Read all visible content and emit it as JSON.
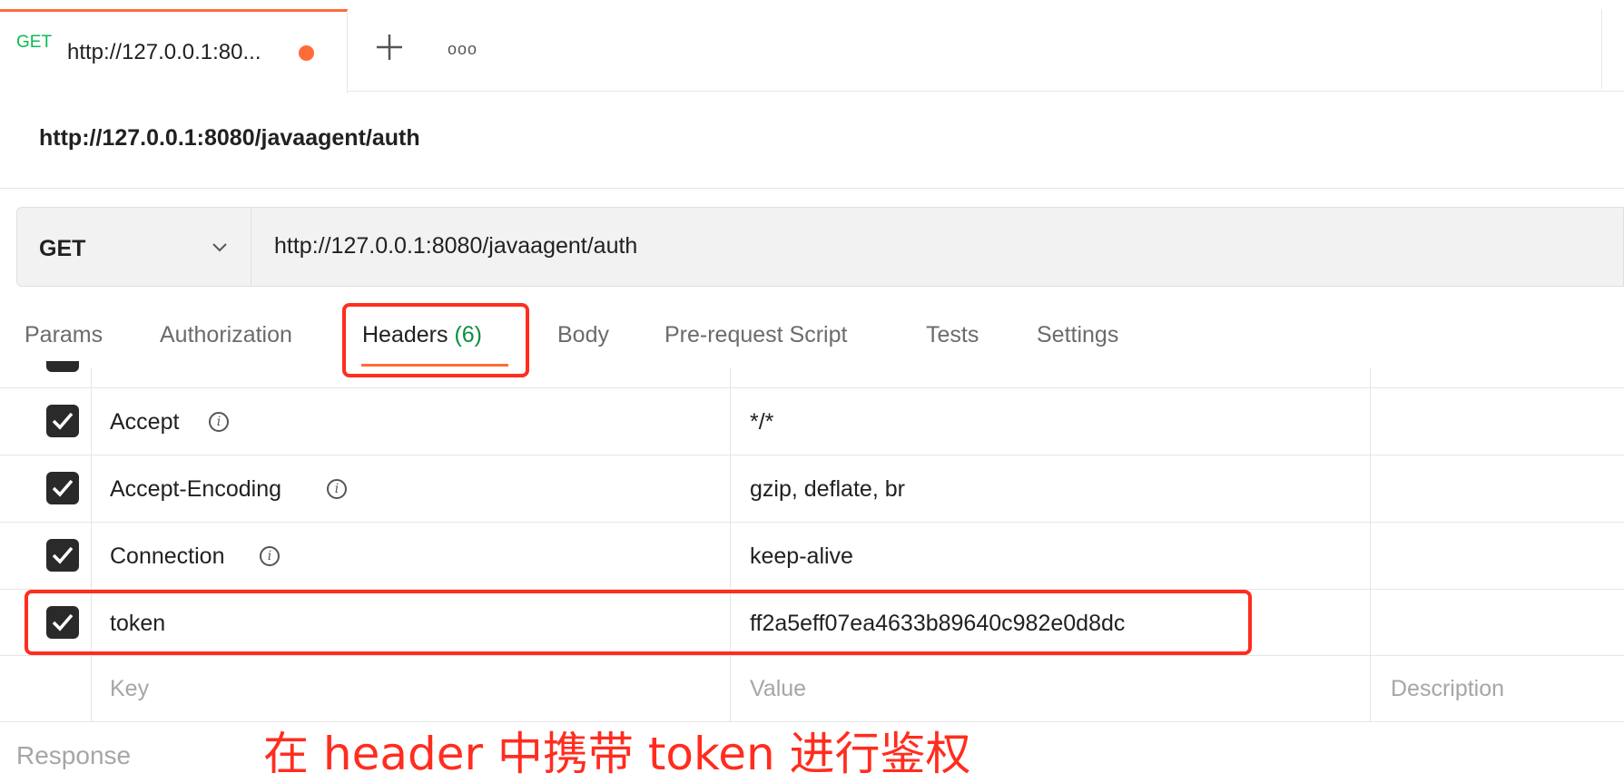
{
  "tab": {
    "method": "GET",
    "title": "http://127.0.0.1:80...",
    "more_label": "ooo"
  },
  "request": {
    "title": "http://127.0.0.1:8080/javaagent/auth",
    "method": "GET",
    "url": "http://127.0.0.1:8080/javaagent/auth"
  },
  "subtabs": {
    "params": "Params",
    "authorization": "Authorization",
    "headers": "Headers",
    "headers_count": "(6)",
    "body": "Body",
    "prerequest": "Pre-request Script",
    "tests": "Tests",
    "settings": "Settings"
  },
  "headers_table": {
    "rows": [
      {
        "key": "Accept",
        "value": "*/*",
        "checked": true,
        "info": true
      },
      {
        "key": "Accept-Encoding",
        "value": "gzip, deflate, br",
        "checked": true,
        "info": true
      },
      {
        "key": "Connection",
        "value": "keep-alive",
        "checked": true,
        "info": true
      },
      {
        "key": "token",
        "value": "ff2a5eff07ea4633b89640c982e0d8dc",
        "checked": true,
        "info": false
      }
    ],
    "placeholders": {
      "key": "Key",
      "value": "Value",
      "description": "Description"
    }
  },
  "response": {
    "label": "Response"
  },
  "annotation": "在 header 中携带 token 进行鉴权",
  "colors": {
    "accent": "#ff6c37",
    "highlight": "#ff2d1f",
    "method_green": "#0cbb52",
    "count_green": "#0a8f3e"
  }
}
